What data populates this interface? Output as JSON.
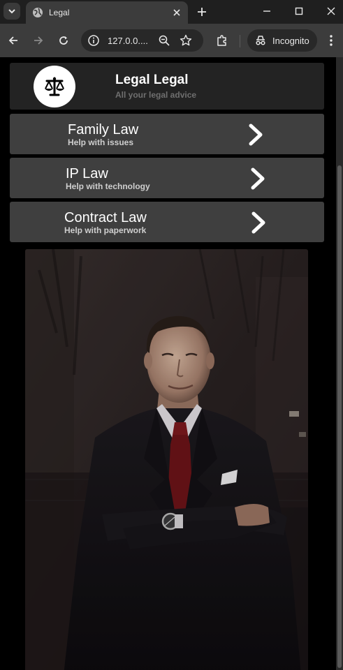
{
  "browser": {
    "tab_title": "Legal",
    "url": "127.0.0....",
    "profile_label": "Incognito"
  },
  "header": {
    "title": "Legal Legal",
    "subtitle": "All your legal advice",
    "logo_icon": "scales-of-justice-icon"
  },
  "services": [
    {
      "name": "Family Law",
      "description": "Help with issues"
    },
    {
      "name": "IP Law",
      "description": "Help with technology"
    },
    {
      "name": "Contract Law",
      "description": "Help with paperwork"
    }
  ],
  "hero_image": "lawyer-portrait",
  "colors": {
    "chrome_bg": "#1f1f1f",
    "toolbar_bg": "#3c3c3c",
    "header_card": "#232323",
    "service_card": "#3f3f3f",
    "page_bg": "#000000"
  }
}
